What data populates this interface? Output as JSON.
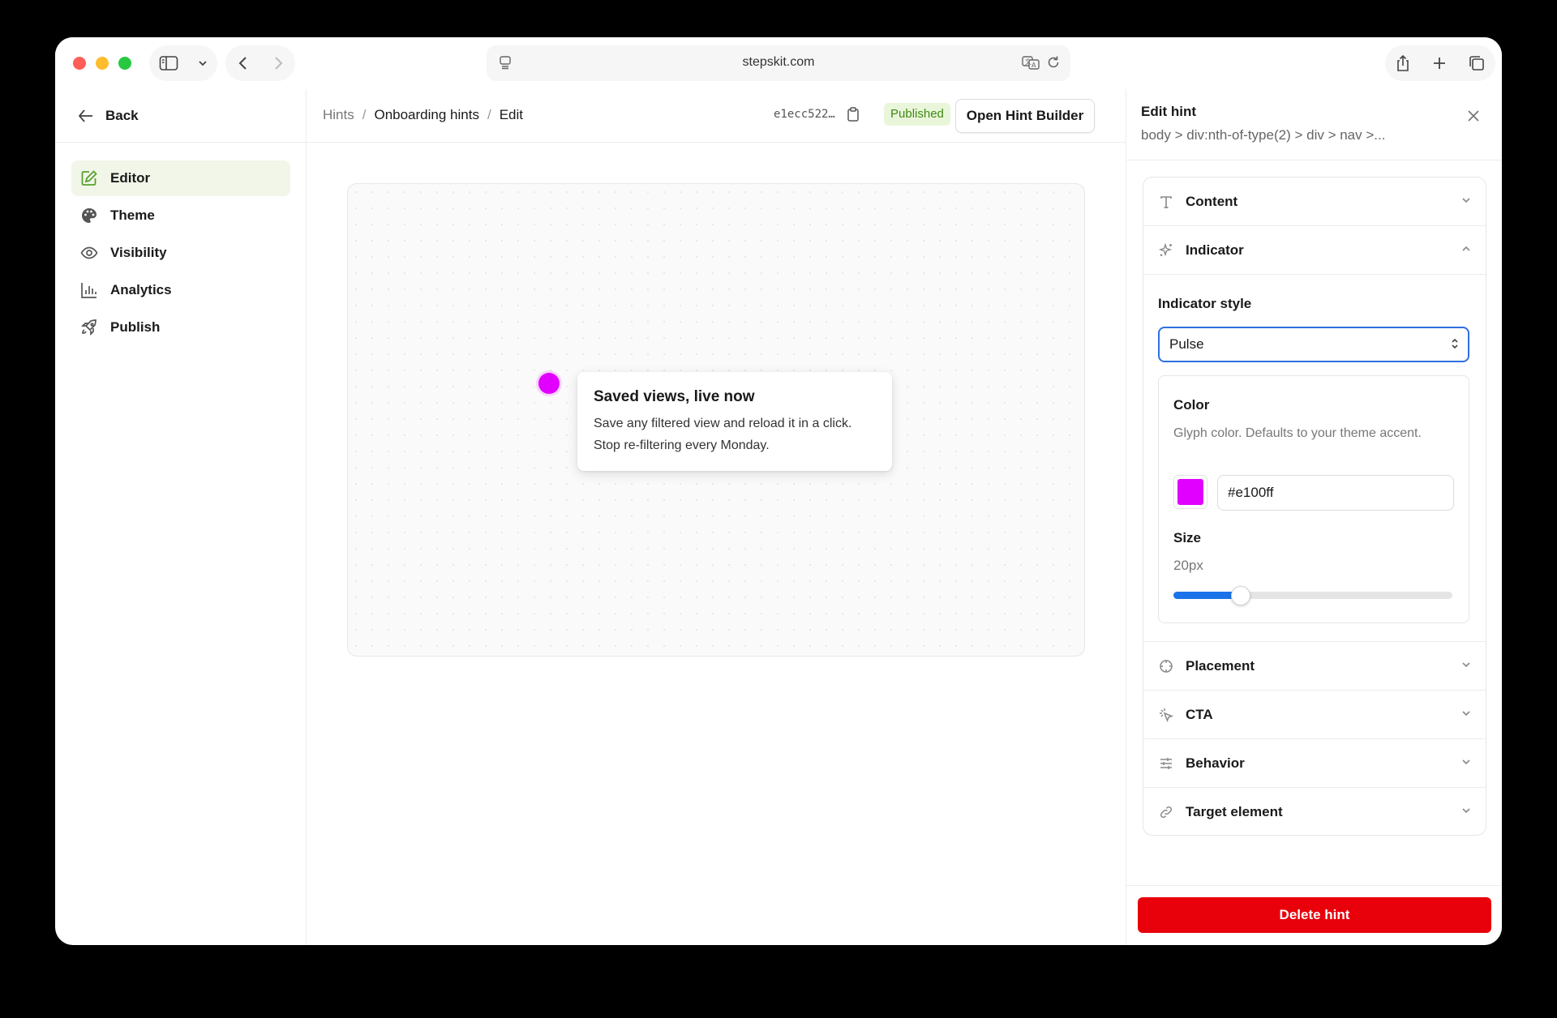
{
  "browser": {
    "url": "stepskit.com"
  },
  "sidebar": {
    "back_label": "Back",
    "items": [
      {
        "label": "Editor",
        "icon": "edit-icon",
        "active": true
      },
      {
        "label": "Theme",
        "icon": "palette-icon",
        "active": false
      },
      {
        "label": "Visibility",
        "icon": "eye-icon",
        "active": false
      },
      {
        "label": "Analytics",
        "icon": "bar-chart-icon",
        "active": false
      },
      {
        "label": "Publish",
        "icon": "rocket-icon",
        "active": false
      }
    ]
  },
  "header": {
    "breadcrumb": [
      "Hints",
      "Onboarding hints",
      "Edit"
    ],
    "separator": "/",
    "hint_id": "e1ecc522…",
    "status": "Published",
    "builder_button": "Open Hint Builder"
  },
  "preview": {
    "indicator_color": "#e100ff",
    "tooltip_title": "Saved views, live now",
    "tooltip_body": "Save any filtered view and reload it in a click. Stop re-filtering every Monday."
  },
  "panel": {
    "title": "Edit hint",
    "selector_path": "body > div:nth-of-type(2) > div > nav >...",
    "sections": {
      "content": "Content",
      "indicator": "Indicator",
      "placement": "Placement",
      "cta": "CTA",
      "behavior": "Behavior",
      "target": "Target element"
    },
    "indicator": {
      "style_label": "Indicator style",
      "style_value": "Pulse",
      "color_label": "Color",
      "color_help": "Glyph color. Defaults to your theme accent.",
      "color_value": "#e100ff",
      "size_label": "Size",
      "size_value": "20px",
      "size_slider_fraction": 0.24
    },
    "delete_button": "Delete hint"
  },
  "colors": {
    "accent_blue": "#2f6fe0",
    "active_green": "#5aa02c",
    "published_bg": "#eaf6d9",
    "danger": "#e8000b"
  }
}
